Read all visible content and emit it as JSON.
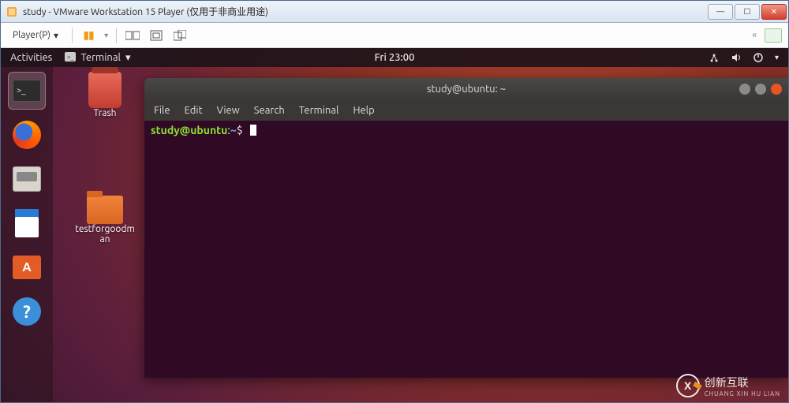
{
  "win": {
    "title": "study - VMware Workstation 15 Player (仅用于非商业用途)",
    "min": "—",
    "max": "☐",
    "close": "✕"
  },
  "vm_toolbar": {
    "player_label": "Player(P)",
    "dropdown_arrow": "▾",
    "collapse": "«"
  },
  "ubuntu": {
    "activities": "Activities",
    "app_indicator": "Terminal",
    "app_arrow": "▾",
    "clock": "Fri 23:00"
  },
  "desktop": {
    "trash": "Trash",
    "folder1": "testforgoodman"
  },
  "terminal": {
    "title": "study@ubuntu: ~",
    "menus": [
      "File",
      "Edit",
      "View",
      "Search",
      "Terminal",
      "Help"
    ],
    "prompt_userhost": "study@ubuntu",
    "prompt_sep": ":",
    "prompt_path": "~",
    "prompt_char": "$"
  },
  "watermark": {
    "text": "创新互联",
    "sub": "CHUANG XIN HU LIAN",
    "logo": "X"
  }
}
